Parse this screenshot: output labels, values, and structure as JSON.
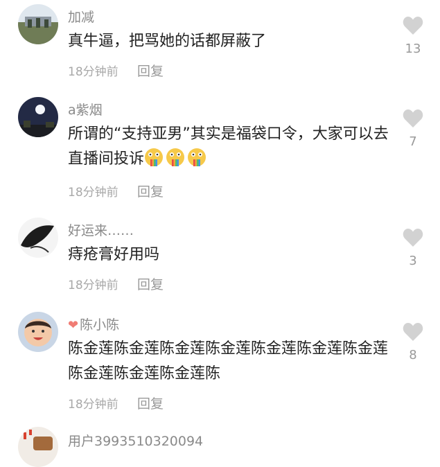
{
  "colors": {
    "username": "#8a8a8a",
    "text": "#222222",
    "meta": "#a8a8a8",
    "heart_icon": "#d2d2d2",
    "vip_heart": "#f07c74"
  },
  "comments": [
    {
      "username": "加减",
      "text": "真牛逼，把骂她的话都屏蔽了",
      "time": "18分钟前",
      "reply": "回复",
      "likes": "13",
      "avatar_icon": "avatar-photo"
    },
    {
      "username": "a紫烟",
      "text": "所谓的“支持亚男”其实是福袋口令，大家可以去直播间投诉",
      "time": "18分钟前",
      "reply": "回复",
      "likes": "7",
      "avatar_icon": "avatar-photo",
      "emojis": [
        "rainbow-vomit-emoji",
        "rainbow-vomit-emoji",
        "rainbow-vomit-emoji"
      ]
    },
    {
      "username": "好运来……",
      "text": "痔疮膏好用吗",
      "time": "18分钟前",
      "reply": "回复",
      "likes": "3",
      "avatar_icon": "avatar-photo"
    },
    {
      "username": "陈小陈",
      "text": "陈金莲陈金莲陈金莲陈金莲陈金莲陈金莲陈金莲陈金莲陈金莲陈金莲陈",
      "time": "18分钟前",
      "reply": "回复",
      "likes": "8",
      "avatar_icon": "avatar-photo",
      "badge_icon": "heart-badge-icon"
    },
    {
      "username": "用户3993510320094",
      "avatar_icon": "avatar-photo"
    }
  ]
}
